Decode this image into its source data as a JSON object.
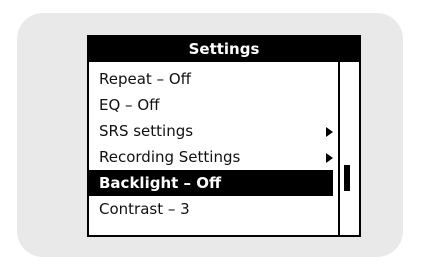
{
  "screen": {
    "title": "Settings",
    "items": [
      {
        "label": "Repeat – Off",
        "has_submenu": false,
        "selected": false
      },
      {
        "label": "EQ – Off",
        "has_submenu": false,
        "selected": false
      },
      {
        "label": "SRS settings",
        "has_submenu": true,
        "selected": false
      },
      {
        "label": "Recording Settings",
        "has_submenu": true,
        "selected": false
      },
      {
        "label": "Backlight – Off",
        "has_submenu": false,
        "selected": true
      },
      {
        "label": "Contrast – 3",
        "has_submenu": false,
        "selected": false
      }
    ],
    "scroll_position": 0.7
  },
  "colors": {
    "device_bezel": "#e9e9e9",
    "screen_bg": "#ffffff",
    "highlight": "#000000"
  }
}
